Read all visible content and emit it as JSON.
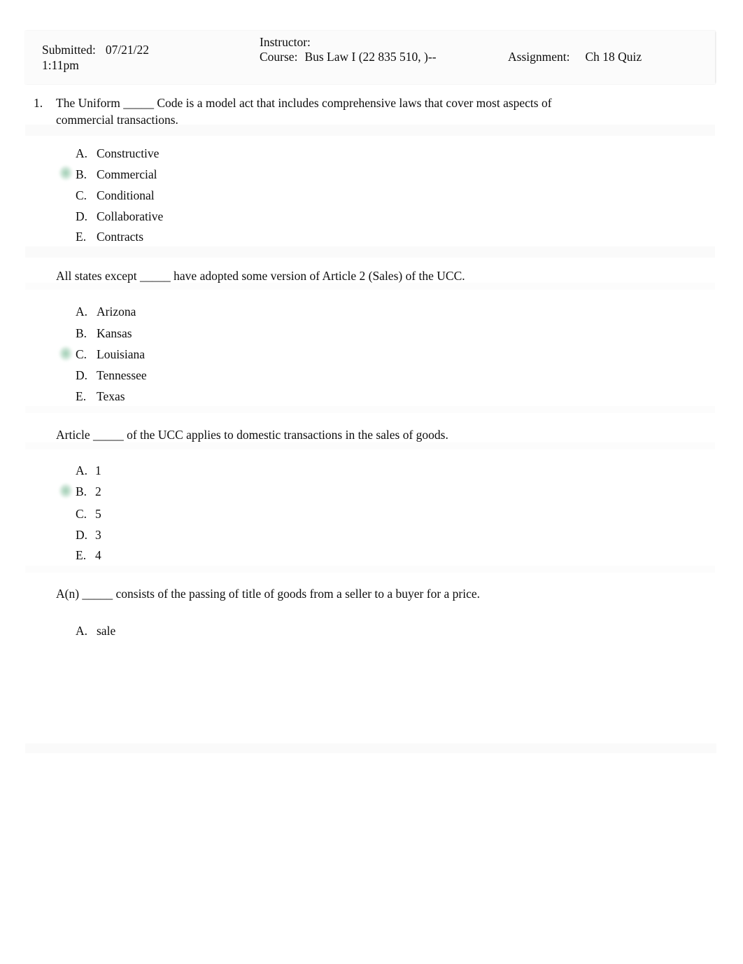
{
  "header": {
    "submitted_label": "Submitted:",
    "submitted_date": "07/21/22",
    "submitted_time": "1:11pm",
    "instructor_label": "Instructor:",
    "instructor_value": "",
    "course_label": "Course:",
    "course_value": "Bus Law I (22 835 510,    )--",
    "assignment_label": "Assignment:",
    "assignment_value": "Ch 18 Quiz"
  },
  "questions": [
    {
      "number": "1.",
      "text": "The Uniform _____ Code is a model act that includes comprehensive laws that cover most aspects of commercial transactions.",
      "options": [
        {
          "letter": "A.",
          "text": "Constructive",
          "selected": false
        },
        {
          "letter": "B.",
          "text": "Commercial",
          "selected": true
        },
        {
          "letter": "C.",
          "text": "Conditional",
          "selected": false
        },
        {
          "letter": "D.",
          "text": "Collaborative",
          "selected": false
        },
        {
          "letter": "E.",
          "text": "Contracts",
          "selected": false
        }
      ]
    },
    {
      "number": "",
      "text": "All states except _____ have adopted some version of Article 2 (Sales) of the UCC.",
      "options": [
        {
          "letter": "A.",
          "text": "Arizona",
          "selected": false
        },
        {
          "letter": "B.",
          "text": "Kansas",
          "selected": false
        },
        {
          "letter": "C.",
          "text": "Louisiana",
          "selected": true
        },
        {
          "letter": "D.",
          "text": "Tennessee",
          "selected": false
        },
        {
          "letter": "E.",
          "text": "Texas",
          "selected": false
        }
      ]
    },
    {
      "number": "",
      "text": "Article _____ of the UCC applies to domestic transactions in the sales of goods.",
      "options": [
        {
          "letter": "A.",
          "text": "1",
          "selected": false
        },
        {
          "letter": "B.",
          "text": "2",
          "selected": true
        },
        {
          "letter": "C.",
          "text": "5",
          "selected": false
        },
        {
          "letter": "D.",
          "text": "3",
          "selected": false
        },
        {
          "letter": "E.",
          "text": "4",
          "selected": false
        }
      ]
    },
    {
      "number": "",
      "text": "A(n) _____ consists of the passing of title of goods from a seller to a buyer for a price.",
      "options": [
        {
          "letter": "A.",
          "text": "sale",
          "selected": false
        }
      ]
    }
  ],
  "colors": {
    "highlight_green": "#9cc8ac",
    "page_background": "#ffffff",
    "separator_band": "#fafafa",
    "text": "#0d0d0d"
  }
}
